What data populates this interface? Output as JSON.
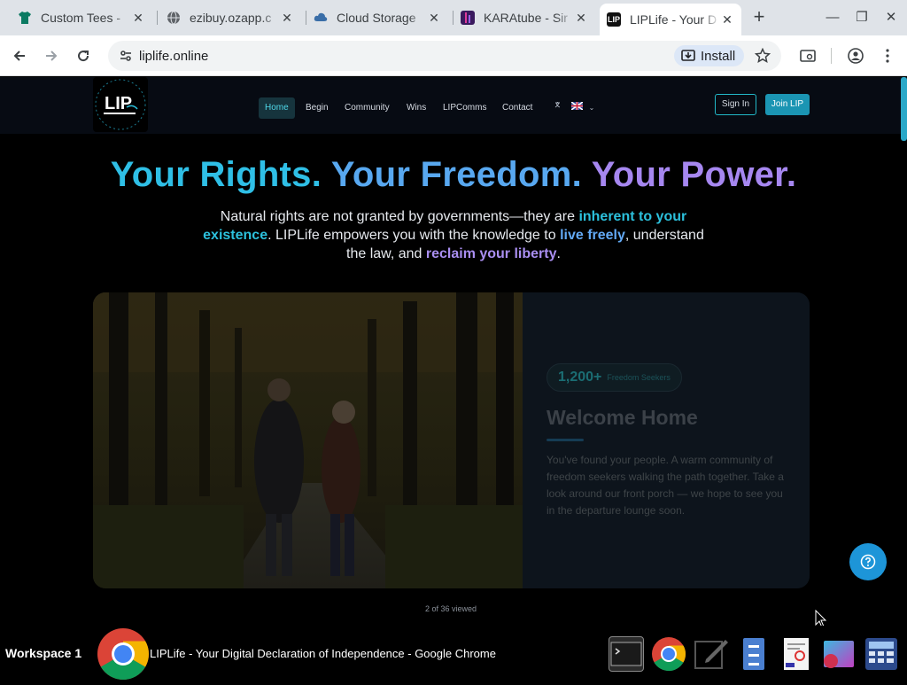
{
  "browser": {
    "tabs": [
      {
        "title": "Custom Tees - ",
        "favicon": "tshirt-icon",
        "color": "#0b7a62"
      },
      {
        "title": "ezibuy.ozapp.c",
        "favicon": "globe-icon",
        "color": "#5f6368"
      },
      {
        "title": "Cloud Storage",
        "favicon": "cloud-icon",
        "color": "#3a6ea8"
      },
      {
        "title": "KARAtube - Sir",
        "favicon": "karatube-icon",
        "color": "#3a1a5e"
      },
      {
        "title": "LIPLife - Your D",
        "favicon": "lip-icon",
        "color": "#111111"
      }
    ],
    "url": "liplife.online",
    "install_label": "Install"
  },
  "site": {
    "nav": [
      "Home",
      "Begin",
      "Community",
      "Wins",
      "LIPComms",
      "Contact"
    ],
    "lang_icon": "translate-icon",
    "signin": "Sign In",
    "join": "Join LIP",
    "hero": {
      "part1": "Your Rights.",
      "part2": "Your Freedom.",
      "part3": "Your Power."
    },
    "intro": {
      "t1": "Natural rights are not granted by governments—they are ",
      "h1": "inherent to your existence",
      "t2": ". LIPLife empowers you with the knowledge to ",
      "h2": "live freely",
      "t3": ", understand the law, and ",
      "h3": "reclaim your liberty",
      "t4": "."
    },
    "card": {
      "badge_number": "1,200+",
      "badge_label": "Freedom Seekers",
      "heading": "Welcome Home",
      "text": "You've found your people. A warm community of freedom seekers walking the path together. Take a look around our front porch — we hope to see you in the departure lounge soon."
    },
    "viewed": "2 of 36 viewed"
  },
  "taskbar": {
    "workspace": "Workspace 1",
    "window_title": "LIPLife - Your Digital Declaration of Independence - Google Chrome"
  },
  "colors": {
    "accent": "#1b95b3",
    "hero_cyan": "#2fbfe6",
    "hero_blue": "#58a8f0",
    "hero_purple": "#a687f0"
  }
}
